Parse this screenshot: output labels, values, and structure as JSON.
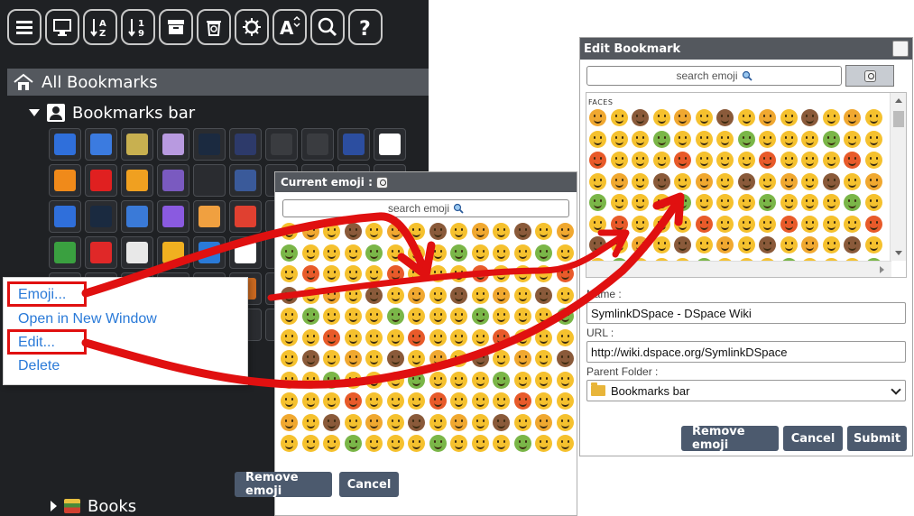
{
  "left_panel": {
    "toolbar_icons": [
      "menu-icon",
      "monitor-icon",
      "sort-alpha-icon",
      "sort-numeric-icon",
      "archive-icon",
      "recycle-bin-icon",
      "settings-icon",
      "font-size-icon",
      "search-icon",
      "help-icon"
    ],
    "tree": {
      "root_label": "All Bookmarks",
      "bar_label": "Bookmarks bar",
      "books_label": "Books"
    },
    "favicon_rows": [
      [
        "#2f6fdb",
        "#3b7be0",
        "#c8b050",
        "#b89ae0",
        "#1b2a40",
        "#2d3a6a",
        "#3a3c40",
        "#3a3c40",
        "#2c4ea0",
        "#ffffff"
      ],
      [
        "#f08a1a",
        "#e02020",
        "#f0a020",
        "#7a5ac0",
        "#2a2c30",
        "#3a5a9a",
        "#2a2c30",
        "#2a2c30",
        "#2a2c30",
        "#2a2c30"
      ],
      [
        "#2f6fdb",
        "#1a2a40",
        "#3a7ad8",
        "#8a5ae0",
        "#f0a040",
        "#e04030",
        "#2a2c30",
        "#2a2c30",
        "#2a2c30",
        "#2a2c30"
      ],
      [
        "#3aa040",
        "#e02828",
        "#e8e8e8",
        "#f0b020",
        "#2a7ad8",
        "#ffffff",
        "#2a2c30",
        "#2a2c30",
        "#2a2c30",
        "#2a2c30"
      ],
      [
        "#c0c0c0",
        "#2f6fdb",
        "#2a5a9a",
        "#e8a830",
        "#e868a0",
        "#c86820",
        "#2a2c30",
        "#2a2c30",
        "#2a2c30",
        "#2a2c30"
      ],
      [
        "#2a4a90",
        "#e8c8a0",
        "#2a2a60",
        "#d8a030",
        "#3a3c40",
        "#2a2c30",
        "#2a2c30",
        "#2a2c30",
        "#2a2c30",
        "#2a2c30"
      ],
      [
        "#e8a020",
        "#303030",
        "#1a1a1a",
        "#50a0c0"
      ]
    ]
  },
  "context_menu": {
    "items": [
      "Emoji...",
      "Open in New Window",
      "Edit...",
      "Delete"
    ]
  },
  "emoji_picker": {
    "title": "Current emoji :",
    "search_placeholder": "search emoji",
    "remove_button": "Remove emoji",
    "cancel_button": "Cancel"
  },
  "edit_dialog": {
    "title": "Edit Bookmark",
    "search_placeholder": "search emoji",
    "category_label": "FACES",
    "name_label": "Name :",
    "name_value": "SymlinkDSpace - DSpace Wiki",
    "url_label": "URL :",
    "url_value": "http://wiki.dspace.org/SymlinkDSpace",
    "folder_label": "Parent Folder :",
    "folder_value": "Bookmarks bar",
    "remove_button": "Remove emoji",
    "cancel_button": "Cancel",
    "submit_button": "Submit"
  },
  "colors": {
    "panel_dark": "#1f2124",
    "title_bar": "#54585e",
    "button": "#4c5a6e",
    "annotation_red": "#e01010",
    "menu_link": "#2a7ad8",
    "emoji_yellow": "#f5c12e"
  }
}
